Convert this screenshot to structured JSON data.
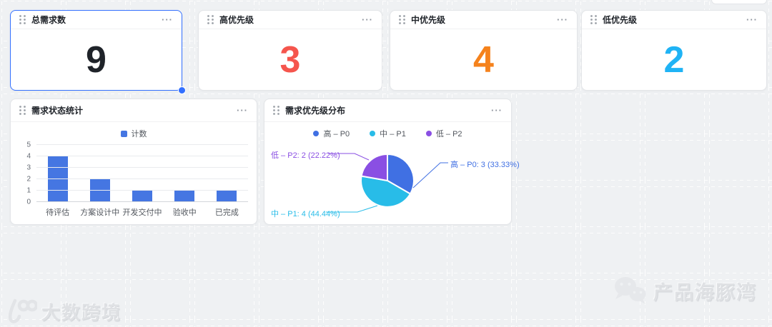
{
  "ui": {
    "more_menu": "···"
  },
  "kpi_cards": [
    {
      "title": "总需求数",
      "value": "9",
      "value_color": "#1f2329",
      "selected": true
    },
    {
      "title": "高优先级",
      "value": "3",
      "value_color": "#f5554d",
      "selected": false
    },
    {
      "title": "中优先级",
      "value": "4",
      "value_color": "#f5821c",
      "selected": false
    },
    {
      "title": "低优先级",
      "value": "2",
      "value_color": "#1fb3f5",
      "selected": false
    }
  ],
  "bar_card": {
    "title": "需求状态统计",
    "legend": {
      "label": "计数",
      "color": "#4576e2"
    }
  },
  "pie_card": {
    "title": "需求优先级分布",
    "legend": [
      {
        "label": "高 – P0",
        "color": "#4070e3"
      },
      {
        "label": "中 – P1",
        "color": "#28bce8"
      },
      {
        "label": "低 – P2",
        "color": "#8a4fe3"
      }
    ],
    "labels": [
      {
        "text": "低 – P2: 2 (22.22%)",
        "color": "#8a4fe3"
      },
      {
        "text": "高 – P0: 3 (33.33%)",
        "color": "#4070e3"
      },
      {
        "text": "中 – P1: 4 (44.44%)",
        "color": "#28bce8"
      }
    ]
  },
  "chart_data": [
    {
      "type": "bar",
      "title": "需求状态统计",
      "series_name": "计数",
      "categories": [
        "待评估",
        "方案设计中",
        "开发交付中",
        "验收中",
        "已完成"
      ],
      "values": [
        4,
        2,
        1,
        1,
        1
      ],
      "ylim": [
        0,
        5
      ],
      "ytick_step": 1,
      "bar_color": "#4576e2",
      "grid": true,
      "legend_position": "top"
    },
    {
      "type": "pie",
      "title": "需求优先级分布",
      "slices": [
        {
          "label": "高 – P0",
          "value": 3,
          "pct": "33.33%",
          "color": "#4070e3"
        },
        {
          "label": "中 – P1",
          "value": 4,
          "pct": "44.44%",
          "color": "#28bce8"
        },
        {
          "label": "低 – P2",
          "value": 2,
          "pct": "22.22%",
          "color": "#8a4fe3"
        }
      ],
      "start_angle_deg": 0,
      "direction": "clockwise",
      "legend_position": "top"
    }
  ],
  "watermarks": {
    "left": "大数跨境",
    "right": "产品海豚湾"
  },
  "colors": {
    "background": "#eff1f3",
    "selection": "#3370ff",
    "card_border": "#e3e5e8"
  }
}
